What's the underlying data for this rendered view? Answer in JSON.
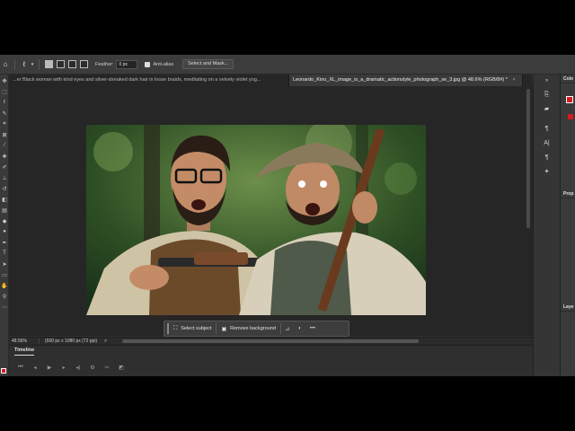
{
  "options_bar": {
    "feather_label": "Feather:",
    "feather_value": "0 px",
    "anti_alias_label": "Anti-alias",
    "select_mask_label": "Select and Mask..."
  },
  "tabs": [
    {
      "label": "...er Black woman with kind eyes and silver-streaked dark hair in loose braids, meditating on a velvety violet yog...",
      "close": "×"
    },
    {
      "label": "Leonardo_Kino_XL_image_is_a_dramatic_actionstyle_photograph_se_3.jpg @ 48.6% (RGB/8#) *",
      "close": "×"
    }
  ],
  "taskbar": {
    "select_subject_label": "Select subject",
    "remove_background_label": "Remove background",
    "more_label": "•••"
  },
  "status_bar": {
    "zoom": "48.56%",
    "doc_info": "(600 px x 1080 px (72 ppi)",
    "arrow": ">"
  },
  "timeline": {
    "title": "Timeline"
  },
  "right_panels": {
    "color_label": "Colo",
    "properties_label": "Prop",
    "layers_label": "Laye"
  },
  "colors": {
    "foreground": "#d71920",
    "app_bg": "#323232",
    "workspace_bg": "#262626"
  }
}
